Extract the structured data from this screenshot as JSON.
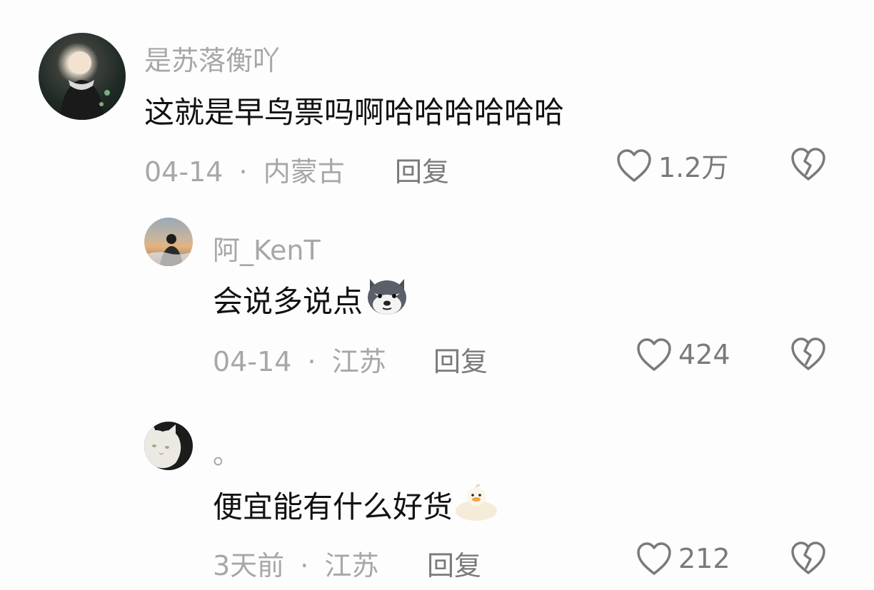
{
  "comments": [
    {
      "username": "是苏落衡吖",
      "text": "这就是早鸟票吗啊哈哈哈哈哈哈",
      "date": "04-14",
      "separator": "·",
      "location": "内蒙古",
      "reply_label": "回复",
      "likes": "1.2万",
      "avatar": "avatar-girl-photo",
      "emoji": ""
    },
    {
      "username": "阿_KenT",
      "text": "会说多说点",
      "date": "04-14",
      "separator": "·",
      "location": "江苏",
      "reply_label": "回复",
      "likes": "424",
      "avatar": "avatar-sunset-silhouette",
      "emoji": "husky-emoji"
    },
    {
      "username": "。",
      "text": "便宜能有什么好货",
      "date": "3天前",
      "separator": "·",
      "location": "江苏",
      "reply_label": "回复",
      "likes": "212",
      "avatar": "avatar-white-cat",
      "emoji": "duck-emoji"
    }
  ],
  "colors": {
    "background": "#fdfdfd",
    "text": "#111111",
    "meta": "#a7a7a7",
    "action": "#7a7a7a"
  },
  "icons": {
    "like": "heart-outline-icon",
    "dislike": "broken-heart-icon"
  }
}
